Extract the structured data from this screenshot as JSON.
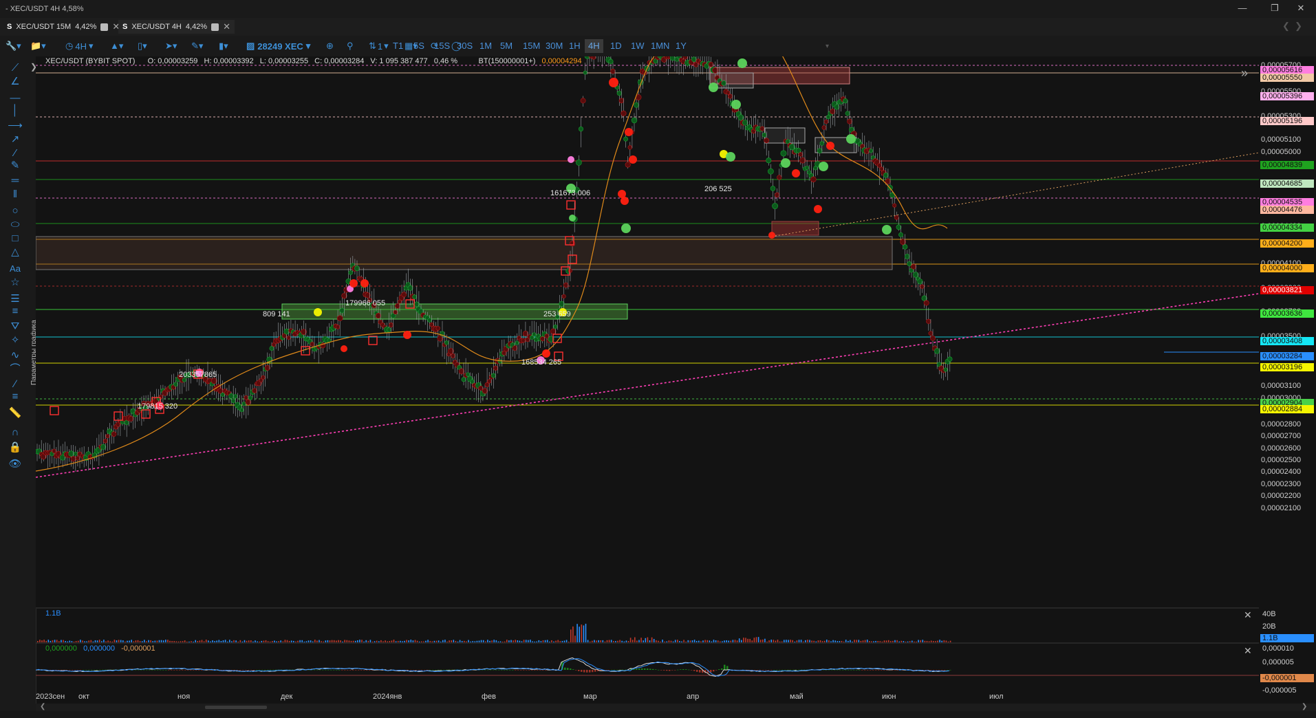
{
  "window": {
    "title": "- XEC/USDT 4H  4,58%"
  },
  "tabs": [
    {
      "s": "S",
      "label": "XEC/USDT 15M",
      "pct": "4,42%"
    },
    {
      "s": "S",
      "label": "XEC/USDT 4H",
      "pct": "4,42%"
    }
  ],
  "toolbar": {
    "interval": "4H",
    "multiplier": "1",
    "volume_filter": "28249 XEC",
    "timeframes": [
      "T1",
      "5S",
      "15S",
      "30S",
      "1M",
      "5M",
      "15M",
      "30M",
      "1H",
      "4H",
      "1D",
      "1W",
      "1MN",
      "1Y"
    ],
    "active_timeframe": "4H"
  },
  "info": {
    "symbol": "XEC/USDT (BYBIT SPOT)",
    "open": "O: 0,00003259",
    "high": "H: 0,00003392",
    "low": "L: 0,00003255",
    "close": "C: 0,00003284",
    "volume": "V: 1 095 387 477",
    "change": "0,46 %",
    "bt_label": "BT(150000001+)",
    "bt_value": "0,00004294"
  },
  "side_label": "Параметры графика",
  "price_axis": {
    "plain": [
      "0,00005700",
      "0,00005500",
      "0,00005300",
      "0,00005100",
      "0,00005000",
      "0,00004900",
      "0,00004600",
      "0,00004400",
      "0,00004100",
      "0,00003900",
      "0,00003700",
      "0,00003500",
      "0,00003100",
      "0,00003000",
      "0,00002800",
      "0,00002700",
      "0,00002600",
      "0,00002500",
      "0,00002400",
      "0,00002300",
      "0,00002200",
      "0,00002100"
    ],
    "badges": [
      {
        "text": "0,00005616",
        "bg": "#ff7ee0",
        "fg": "#111"
      },
      {
        "text": "0,00005550",
        "bg": "#f2c9a6",
        "fg": "#111"
      },
      {
        "text": "0,00005396",
        "bg": "#ffb0ee",
        "fg": "#111"
      },
      {
        "text": "0,00005196",
        "bg": "#ffc9c9",
        "fg": "#111"
      },
      {
        "text": "0,00004839",
        "bg": "#1fa31f",
        "fg": "#111"
      },
      {
        "text": "0,00004685",
        "bg": "#bfe6bf",
        "fg": "#111"
      },
      {
        "text": "0,00004535",
        "bg": "#ff7ee0",
        "fg": "#111"
      },
      {
        "text": "0,00004476",
        "bg": "#ffb8a0",
        "fg": "#111"
      },
      {
        "text": "0,00004334",
        "bg": "#43d143",
        "fg": "#111"
      },
      {
        "text": "0,00004200",
        "bg": "#ffae1a",
        "fg": "#111"
      },
      {
        "text": "0,00004000",
        "bg": "#ffae1a",
        "fg": "#111"
      },
      {
        "text": "0,00003821",
        "bg": "#e00000",
        "fg": "#fff"
      },
      {
        "text": "0,00003636",
        "bg": "#3fe63f",
        "fg": "#111"
      },
      {
        "text": "0,00003408",
        "bg": "#14e6f5",
        "fg": "#111"
      },
      {
        "text": "0,00003284",
        "bg": "#2a8fff",
        "fg": "#111"
      },
      {
        "text": "0,00003196",
        "bg": "#f5f500",
        "fg": "#111"
      },
      {
        "text": "0,00002904",
        "bg": "#49d149",
        "fg": "#111"
      },
      {
        "text": "0,00002884",
        "bg": "#f5f500",
        "fg": "#111"
      }
    ]
  },
  "time_axis": [
    "2023сен",
    "окт",
    "ноя",
    "дек",
    "2024янв",
    "фев",
    "мар",
    "апр",
    "май",
    "июн",
    "июл"
  ],
  "annotations": [
    "809 141",
    "179966 055",
    "203357865",
    "179815 320",
    "253 659",
    "168534 265",
    "161673 006",
    "206 525"
  ],
  "volume_pane": {
    "label": "1.1B",
    "axis": [
      "40B",
      "20B"
    ],
    "badge": "1.1B"
  },
  "osc_pane": {
    "values": [
      "0,000000",
      "0,000000",
      "-0,000001"
    ],
    "axis": [
      "0,000010",
      "0,000005",
      "-0,000005"
    ],
    "badge": "-0,000001"
  }
}
